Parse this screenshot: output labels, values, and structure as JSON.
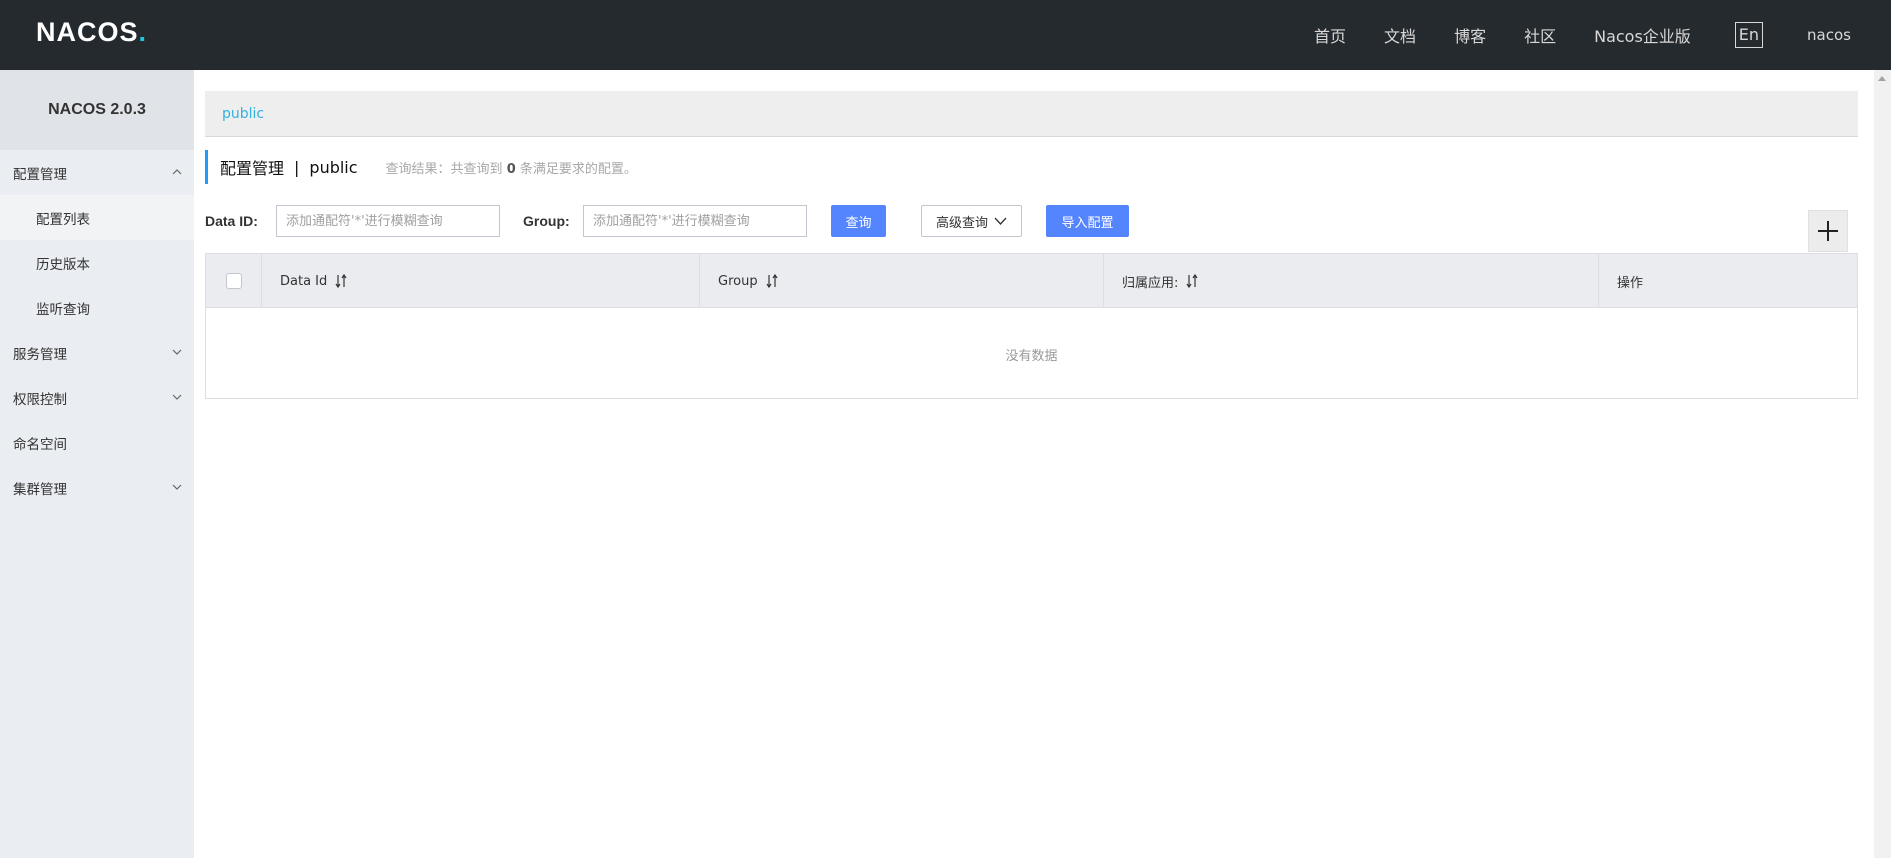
{
  "header": {
    "logo": {
      "n": "N",
      "a": "A",
      "co": "COS",
      "dot": "."
    },
    "nav": [
      "首页",
      "文档",
      "博客",
      "社区",
      "Nacos企业版"
    ],
    "lang": "En",
    "user": "nacos"
  },
  "sidebar": {
    "version": "NACOS 2.0.3",
    "config_menu": "配置管理",
    "config_sub": [
      "配置列表",
      "历史版本",
      "监听查询"
    ],
    "service_menu": "服务管理",
    "auth_menu": "权限控制",
    "namespace_menu": "命名空间",
    "cluster_menu": "集群管理"
  },
  "main": {
    "namespace_tab": "public",
    "title": "配置管理",
    "title_sep": "|",
    "title_ns": "public",
    "result_prefix": "查询结果：共查询到",
    "result_count": "0",
    "result_suffix": "条满足要求的配置。",
    "search": {
      "dataid_label": "Data ID:",
      "dataid_placeholder": "添加通配符'*'进行模糊查询",
      "group_label": "Group:",
      "group_placeholder": "添加通配符'*'进行模糊查询",
      "query_btn": "查询",
      "advanced_btn": "高级查询",
      "import_btn": "导入配置"
    },
    "table": {
      "columns": [
        "Data Id",
        "Group",
        "归属应用:",
        "操作"
      ],
      "empty_text": "没有数据"
    }
  },
  "colors": {
    "topbar": "#252a2f",
    "primary": "#5584ff",
    "accent": "#1ec7e6",
    "link": "#33b2e0"
  }
}
